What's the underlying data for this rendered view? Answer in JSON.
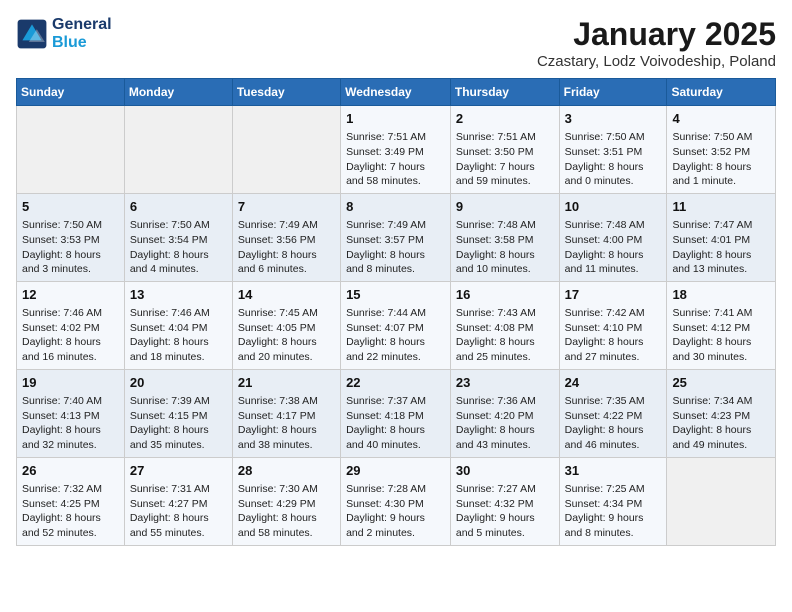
{
  "logo": {
    "line1": "General",
    "line2": "Blue"
  },
  "title": "January 2025",
  "subtitle": "Czastary, Lodz Voivodeship, Poland",
  "days_of_week": [
    "Sunday",
    "Monday",
    "Tuesday",
    "Wednesday",
    "Thursday",
    "Friday",
    "Saturday"
  ],
  "weeks": [
    [
      {
        "day": "",
        "info": ""
      },
      {
        "day": "",
        "info": ""
      },
      {
        "day": "",
        "info": ""
      },
      {
        "day": "1",
        "info": "Sunrise: 7:51 AM\nSunset: 3:49 PM\nDaylight: 7 hours and 58 minutes."
      },
      {
        "day": "2",
        "info": "Sunrise: 7:51 AM\nSunset: 3:50 PM\nDaylight: 7 hours and 59 minutes."
      },
      {
        "day": "3",
        "info": "Sunrise: 7:50 AM\nSunset: 3:51 PM\nDaylight: 8 hours and 0 minutes."
      },
      {
        "day": "4",
        "info": "Sunrise: 7:50 AM\nSunset: 3:52 PM\nDaylight: 8 hours and 1 minute."
      }
    ],
    [
      {
        "day": "5",
        "info": "Sunrise: 7:50 AM\nSunset: 3:53 PM\nDaylight: 8 hours and 3 minutes."
      },
      {
        "day": "6",
        "info": "Sunrise: 7:50 AM\nSunset: 3:54 PM\nDaylight: 8 hours and 4 minutes."
      },
      {
        "day": "7",
        "info": "Sunrise: 7:49 AM\nSunset: 3:56 PM\nDaylight: 8 hours and 6 minutes."
      },
      {
        "day": "8",
        "info": "Sunrise: 7:49 AM\nSunset: 3:57 PM\nDaylight: 8 hours and 8 minutes."
      },
      {
        "day": "9",
        "info": "Sunrise: 7:48 AM\nSunset: 3:58 PM\nDaylight: 8 hours and 10 minutes."
      },
      {
        "day": "10",
        "info": "Sunrise: 7:48 AM\nSunset: 4:00 PM\nDaylight: 8 hours and 11 minutes."
      },
      {
        "day": "11",
        "info": "Sunrise: 7:47 AM\nSunset: 4:01 PM\nDaylight: 8 hours and 13 minutes."
      }
    ],
    [
      {
        "day": "12",
        "info": "Sunrise: 7:46 AM\nSunset: 4:02 PM\nDaylight: 8 hours and 16 minutes."
      },
      {
        "day": "13",
        "info": "Sunrise: 7:46 AM\nSunset: 4:04 PM\nDaylight: 8 hours and 18 minutes."
      },
      {
        "day": "14",
        "info": "Sunrise: 7:45 AM\nSunset: 4:05 PM\nDaylight: 8 hours and 20 minutes."
      },
      {
        "day": "15",
        "info": "Sunrise: 7:44 AM\nSunset: 4:07 PM\nDaylight: 8 hours and 22 minutes."
      },
      {
        "day": "16",
        "info": "Sunrise: 7:43 AM\nSunset: 4:08 PM\nDaylight: 8 hours and 25 minutes."
      },
      {
        "day": "17",
        "info": "Sunrise: 7:42 AM\nSunset: 4:10 PM\nDaylight: 8 hours and 27 minutes."
      },
      {
        "day": "18",
        "info": "Sunrise: 7:41 AM\nSunset: 4:12 PM\nDaylight: 8 hours and 30 minutes."
      }
    ],
    [
      {
        "day": "19",
        "info": "Sunrise: 7:40 AM\nSunset: 4:13 PM\nDaylight: 8 hours and 32 minutes."
      },
      {
        "day": "20",
        "info": "Sunrise: 7:39 AM\nSunset: 4:15 PM\nDaylight: 8 hours and 35 minutes."
      },
      {
        "day": "21",
        "info": "Sunrise: 7:38 AM\nSunset: 4:17 PM\nDaylight: 8 hours and 38 minutes."
      },
      {
        "day": "22",
        "info": "Sunrise: 7:37 AM\nSunset: 4:18 PM\nDaylight: 8 hours and 40 minutes."
      },
      {
        "day": "23",
        "info": "Sunrise: 7:36 AM\nSunset: 4:20 PM\nDaylight: 8 hours and 43 minutes."
      },
      {
        "day": "24",
        "info": "Sunrise: 7:35 AM\nSunset: 4:22 PM\nDaylight: 8 hours and 46 minutes."
      },
      {
        "day": "25",
        "info": "Sunrise: 7:34 AM\nSunset: 4:23 PM\nDaylight: 8 hours and 49 minutes."
      }
    ],
    [
      {
        "day": "26",
        "info": "Sunrise: 7:32 AM\nSunset: 4:25 PM\nDaylight: 8 hours and 52 minutes."
      },
      {
        "day": "27",
        "info": "Sunrise: 7:31 AM\nSunset: 4:27 PM\nDaylight: 8 hours and 55 minutes."
      },
      {
        "day": "28",
        "info": "Sunrise: 7:30 AM\nSunset: 4:29 PM\nDaylight: 8 hours and 58 minutes."
      },
      {
        "day": "29",
        "info": "Sunrise: 7:28 AM\nSunset: 4:30 PM\nDaylight: 9 hours and 2 minutes."
      },
      {
        "day": "30",
        "info": "Sunrise: 7:27 AM\nSunset: 4:32 PM\nDaylight: 9 hours and 5 minutes."
      },
      {
        "day": "31",
        "info": "Sunrise: 7:25 AM\nSunset: 4:34 PM\nDaylight: 9 hours and 8 minutes."
      },
      {
        "day": "",
        "info": ""
      }
    ]
  ]
}
